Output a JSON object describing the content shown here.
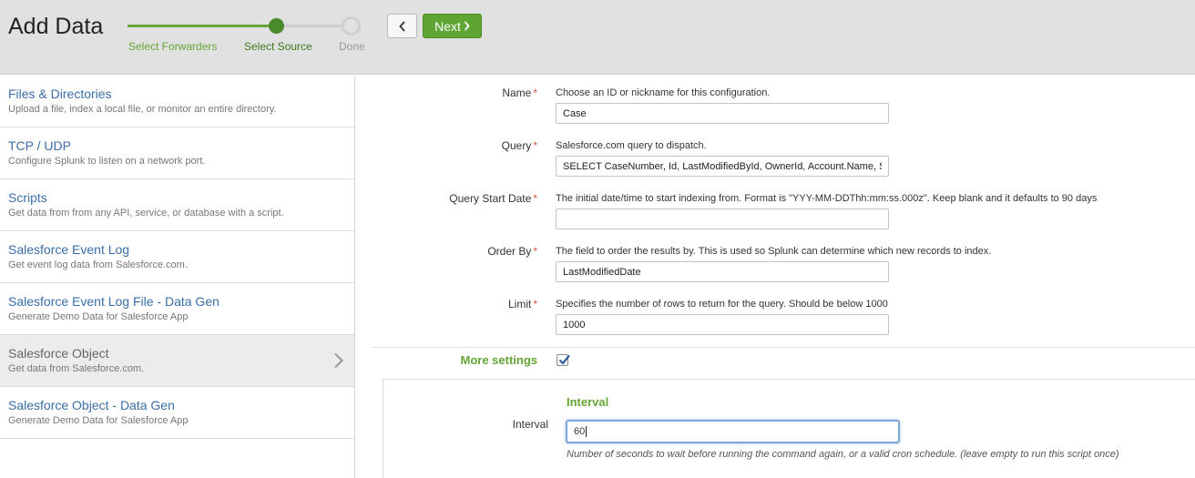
{
  "header": {
    "title": "Add Data",
    "steps": [
      "Select Forwarders",
      "Select Source",
      "Done"
    ],
    "next_label": "Next"
  },
  "sidebar": {
    "items": [
      {
        "title": "Files & Directories",
        "desc": "Upload a file, index a local file, or monitor an entire directory."
      },
      {
        "title": "TCP / UDP",
        "desc": "Configure Splunk to listen on a network port."
      },
      {
        "title": "Scripts",
        "desc": "Get data from from any API, service, or database with a script."
      },
      {
        "title": "Salesforce Event Log",
        "desc": "Get event log data from Salesforce.com."
      },
      {
        "title": "Salesforce Event Log File - Data Gen",
        "desc": "Generate Demo Data for Salesforce App"
      },
      {
        "title": "Salesforce Object",
        "desc": "Get data from Salesforce.com."
      },
      {
        "title": "Salesforce Object - Data Gen",
        "desc": "Generate Demo Data for Salesforce App"
      }
    ]
  },
  "form": {
    "required_mark": "*",
    "name": {
      "label": "Name",
      "help": "Choose an ID or nickname for this configuration.",
      "value": "Case"
    },
    "query": {
      "label": "Query",
      "help": "Salesforce.com query to dispatch.",
      "value": "SELECT CaseNumber, Id, LastModifiedById, OwnerId, Account.Name, S"
    },
    "query_start_date": {
      "label": "Query Start Date",
      "help": "The initial date/time to start indexing from. Format is \"YYY-MM-DDThh:mm:ss.000z\". Keep blank and it defaults to 90 days",
      "value": ""
    },
    "order_by": {
      "label": "Order By",
      "help": "The field to order the results by. This is used so Splunk can determine which new records to index.",
      "value": "LastModifiedDate"
    },
    "limit": {
      "label": "Limit",
      "help": "Specifies the number of rows to return for the query. Should be below 1000",
      "value": "1000"
    },
    "more_settings": {
      "label": "More settings",
      "checked": true
    },
    "interval": {
      "heading": "Interval",
      "label": "Interval",
      "value": "60",
      "help": "Number of seconds to wait before running the command again, or a valid cron schedule. (leave empty to run this script once)"
    }
  },
  "colors": {
    "accent_green": "#65a637",
    "link_blue": "#3b6ea8",
    "required_red": "#d6563c"
  }
}
